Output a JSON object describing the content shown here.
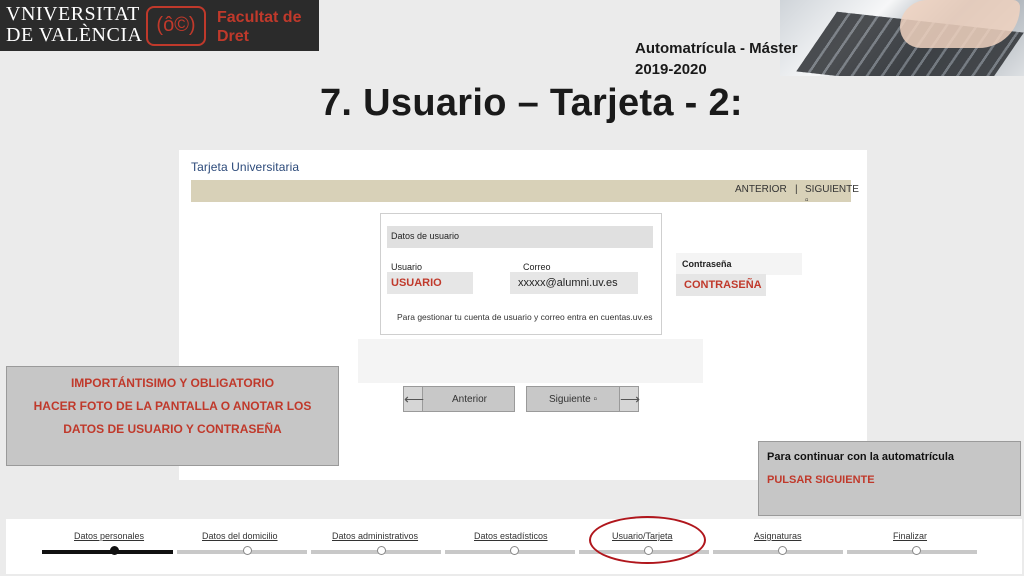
{
  "header": {
    "logo_line1": "VNIVERSITAT",
    "logo_line2": "DE VALÈNCIA",
    "logo_emblem": "(ô©)",
    "faculty_line1": "Facultat de",
    "faculty_line2": "Dret",
    "subtitle_line1": "Automatrícula - Máster",
    "subtitle_line2": "2019-2020",
    "title": "7. Usuario – Tarjeta - 2:"
  },
  "panel": {
    "title": "Tarjeta Universitaria",
    "nav_prev": "ANTERIOR",
    "nav_sep": "|",
    "nav_next": "SIGUIENTE ▫",
    "user_box_title": "Datos de usuario",
    "usuario_label": "Usuario",
    "usuario_value": "USUARIO",
    "correo_label": "Correo",
    "correo_value": "xxxxx@alumni.uv.es",
    "manage_note": "Para gestionar tu cuenta de usuario y correo entra en cuentas.uv.es",
    "password_label": "Contraseña",
    "password_value": "CONTRASEÑA",
    "btn_prev_arrow": "⟵",
    "btn_prev_label": "Anterior",
    "btn_next_label": "Siguiente ▫",
    "btn_next_arrow": "⟶"
  },
  "warning": {
    "line1": "IMPORTÁNTISIMO Y OBLIGATORIO",
    "line2": "HACER FOTO DE LA PANTALLA O ANOTAR LOS",
    "line3": "DATOS DE USUARIO Y CONTRASEÑA"
  },
  "continue_note": {
    "line1": "Para continuar con la automatrícula",
    "line2": "PULSAR SIGUIENTE"
  },
  "progress": {
    "steps": [
      {
        "label": "Datos personales"
      },
      {
        "label": "Datos del domicilio"
      },
      {
        "label": "Datos administrativos"
      },
      {
        "label": "Datos estadísticos"
      },
      {
        "label": "Usuario/Tarjeta"
      },
      {
        "label": "Asignaturas"
      },
      {
        "label": "Finalizar"
      }
    ],
    "current_step": 1
  },
  "colors": {
    "accent_red": "#c0392b",
    "nav_bar": "#d8d1b8",
    "title_blue": "#2c4a7a"
  }
}
